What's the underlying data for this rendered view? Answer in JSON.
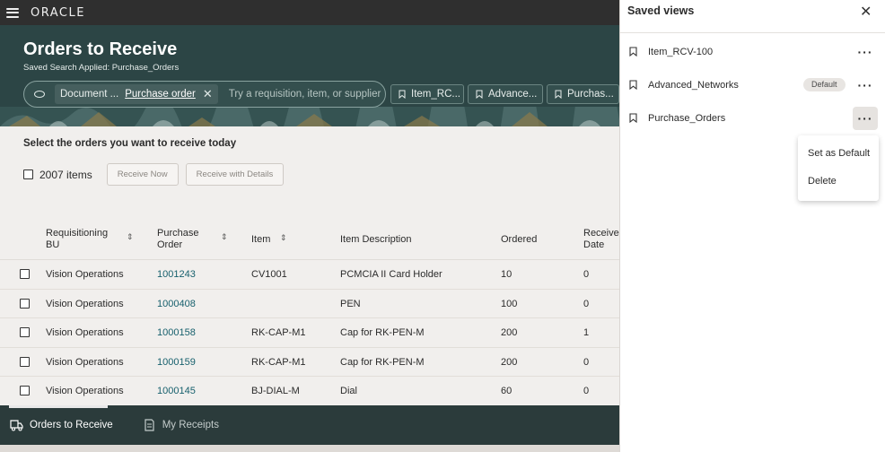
{
  "header": {
    "brand": "ORACLE"
  },
  "hero": {
    "title": "Orders to Receive",
    "saved_search": "Saved Search Applied: Purchase_Orders",
    "filter_chip": {
      "label": "Document ...",
      "value": "Purchase order"
    },
    "search_placeholder": "Try a requisition, item, or supplier",
    "saved_view_chips": [
      "Item_RC...",
      "Advance...",
      "Purchas..."
    ]
  },
  "main": {
    "instruction": "Select the orders you want to receive today",
    "items_count": "2007 items",
    "receive_now_label": "Receive Now",
    "receive_with_details_label": "Receive with Details"
  },
  "table": {
    "columns": [
      "Requisitioning BU",
      "Purchase Order",
      "Item",
      "Item Description",
      "Ordered",
      "Receive Date"
    ],
    "rows": [
      {
        "bu": "Vision Operations",
        "po": "1001243",
        "item": "CV1001",
        "description": "PCMCIA II Card Holder",
        "ordered": "10",
        "received": "0"
      },
      {
        "bu": "Vision Operations",
        "po": "1000408",
        "item": "",
        "description": "PEN",
        "ordered": "100",
        "received": "0"
      },
      {
        "bu": "Vision Operations",
        "po": "1000158",
        "item": "RK-CAP-M1",
        "description": "Cap for RK-PEN-M",
        "ordered": "200",
        "received": "1"
      },
      {
        "bu": "Vision Operations",
        "po": "1000159",
        "item": "RK-CAP-M1",
        "description": "Cap for RK-PEN-M",
        "ordered": "200",
        "received": "0"
      },
      {
        "bu": "Vision Operations",
        "po": "1000145",
        "item": "BJ-DIAL-M",
        "description": "Dial",
        "ordered": "60",
        "received": "0"
      }
    ]
  },
  "bottom_nav": {
    "tabs": [
      {
        "label": "Orders to Receive",
        "icon": "truck-icon",
        "active": true
      },
      {
        "label": "My Receipts",
        "icon": "receipt-icon",
        "active": false
      }
    ]
  },
  "panel": {
    "title": "Saved views",
    "views": [
      {
        "label": "Item_RCV-100",
        "badge": ""
      },
      {
        "label": "Advanced_Networks",
        "badge": "Default"
      },
      {
        "label": "Purchase_Orders",
        "badge": ""
      }
    ],
    "menu": [
      "Set as Default",
      "Delete"
    ]
  },
  "colors": {
    "hero_background": "#2c4545",
    "link": "#17606d",
    "bottom_bar": "#2b3b3b"
  }
}
